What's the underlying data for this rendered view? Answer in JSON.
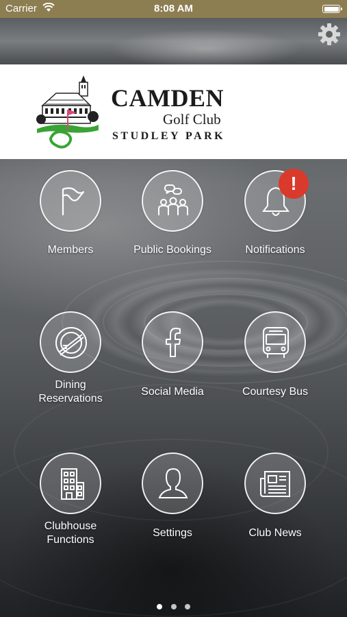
{
  "status_bar": {
    "carrier": "Carrier",
    "time": "8:08 AM"
  },
  "header": {
    "brand_name": "CAMDEN",
    "brand_sub": "Golf Club",
    "brand_place": "STUDLEY PARK"
  },
  "menu": {
    "items": [
      {
        "label": "Members",
        "icon": "flag-icon"
      },
      {
        "label": "Public Bookings",
        "icon": "group-chat-icon"
      },
      {
        "label": "Notifications",
        "icon": "bell-icon",
        "badge": "!"
      },
      {
        "label_line1": "Dining",
        "label_line2": "Reservations",
        "icon": "dining-plate-icon"
      },
      {
        "label": "Social Media",
        "icon": "facebook-icon"
      },
      {
        "label": "Courtesy Bus",
        "icon": "bus-icon"
      },
      {
        "label_line1": "Clubhouse",
        "label_line2": "Functions",
        "icon": "building-icon"
      },
      {
        "label": "Settings",
        "icon": "person-icon"
      },
      {
        "label": "Club News",
        "icon": "newspaper-icon"
      }
    ]
  },
  "pagination": {
    "pages": 3,
    "current": 1
  },
  "colors": {
    "status_bar": "#8d7e52",
    "badge": "#d93a2b",
    "logo_green": "#3aa335",
    "logo_pink": "#d9467a"
  }
}
